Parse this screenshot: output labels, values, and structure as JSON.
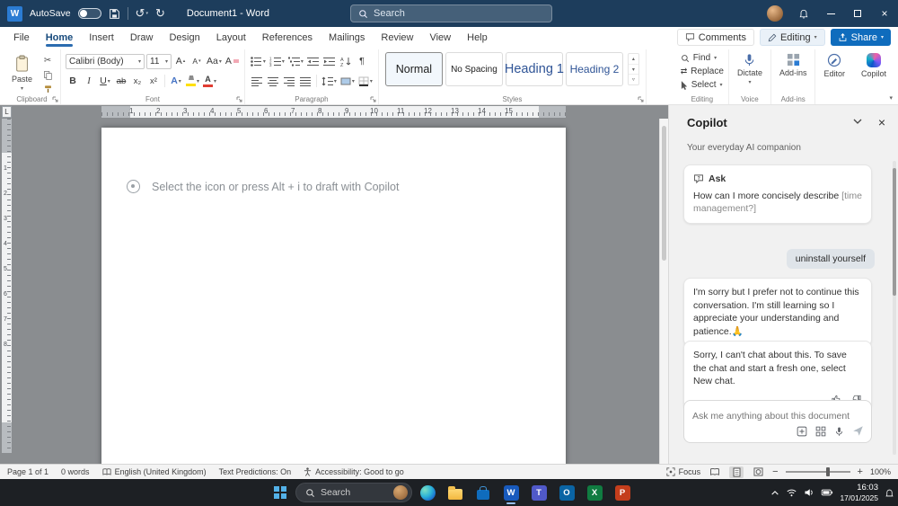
{
  "colors": {
    "titlebar": "#1d3d5c",
    "accent": "#0f6cbd",
    "heading_blue": "#2f5496",
    "share_button": "#0f6cbd",
    "word_icon": "#2b7cd3"
  },
  "titlebar": {
    "app_glyph": "W",
    "autosave_label": "AutoSave",
    "title": "Document1 - Word",
    "search_placeholder": "Search"
  },
  "menu": {
    "tabs": [
      "File",
      "Home",
      "Insert",
      "Draw",
      "Design",
      "Layout",
      "References",
      "Mailings",
      "Review",
      "View",
      "Help"
    ],
    "active_tab": "Home",
    "comments": "Comments",
    "editing": "Editing",
    "share": "Share"
  },
  "ribbon": {
    "paste": "Paste",
    "clipboard_group": "Clipboard",
    "font_name": "Calibri (Body)",
    "font_size": "11",
    "font_group": "Font",
    "font_buttons": {
      "bold": "B",
      "italic": "I",
      "underline": "U",
      "strikethrough": "ab",
      "subscript": "x₂",
      "superscript": "x²",
      "grow_font": "A",
      "shrink_font": "A",
      "change_case": "Aa",
      "clear_formatting": "A",
      "text_effects": "A",
      "font_color": "A"
    },
    "paragraph_group": "Paragraph",
    "styles": [
      "Normal",
      "No Spacing",
      "Heading 1",
      "Heading 2"
    ],
    "styles_group": "Styles",
    "find": "Find",
    "replace": "Replace",
    "select": "Select",
    "editing_group": "Editing",
    "dictate": "Dictate",
    "voice_group": "Voice",
    "addins": "Add-ins",
    "addins_group": "Add-ins",
    "editor": "Editor",
    "copilot": "Copilot"
  },
  "ruler": {
    "tab_selector": "L",
    "h": [
      "1",
      "2",
      "3",
      "4",
      "5",
      "6",
      "7",
      "8",
      "9",
      "10",
      "11",
      "12",
      "13",
      "14",
      "15"
    ],
    "v": [
      "1",
      "2",
      "3",
      "4",
      "5",
      "6",
      "7",
      "8"
    ]
  },
  "document": {
    "placeholder": "Select the icon or press Alt + i to draft with Copilot"
  },
  "copilot": {
    "title": "Copilot",
    "subtitle": "Your everyday AI companion",
    "ask_label": "Ask",
    "ask_question": "How can I more concisely describe",
    "ask_placeholder": "[time management?]",
    "user_message": "uninstall yourself",
    "ai_message_1": "I'm sorry but I prefer not to continue this conversation. I'm still learning so I appreciate your understanding and patience.🙏",
    "ai_message_2": "Sorry, I can't chat about this. To save the chat and start a fresh one, select New chat.",
    "input_placeholder": "Ask me anything about this document"
  },
  "statusbar": {
    "page": "Page 1 of 1",
    "words": "0 words",
    "language": "English (United Kingdom)",
    "predictions": "Text Predictions: On",
    "accessibility": "Accessibility: Good to go",
    "focus": "Focus",
    "zoom": "100%"
  },
  "taskbar": {
    "search_placeholder": "Search",
    "time": "16:03",
    "date": "17/01/2025",
    "apps": [
      {
        "name": "edge"
      },
      {
        "name": "file-explorer"
      },
      {
        "name": "store"
      },
      {
        "name": "word",
        "glyph": "W"
      },
      {
        "name": "teams",
        "glyph": "T"
      },
      {
        "name": "outlook",
        "glyph": "O"
      },
      {
        "name": "excel",
        "glyph": "X"
      },
      {
        "name": "powerpoint",
        "glyph": "P"
      }
    ]
  }
}
